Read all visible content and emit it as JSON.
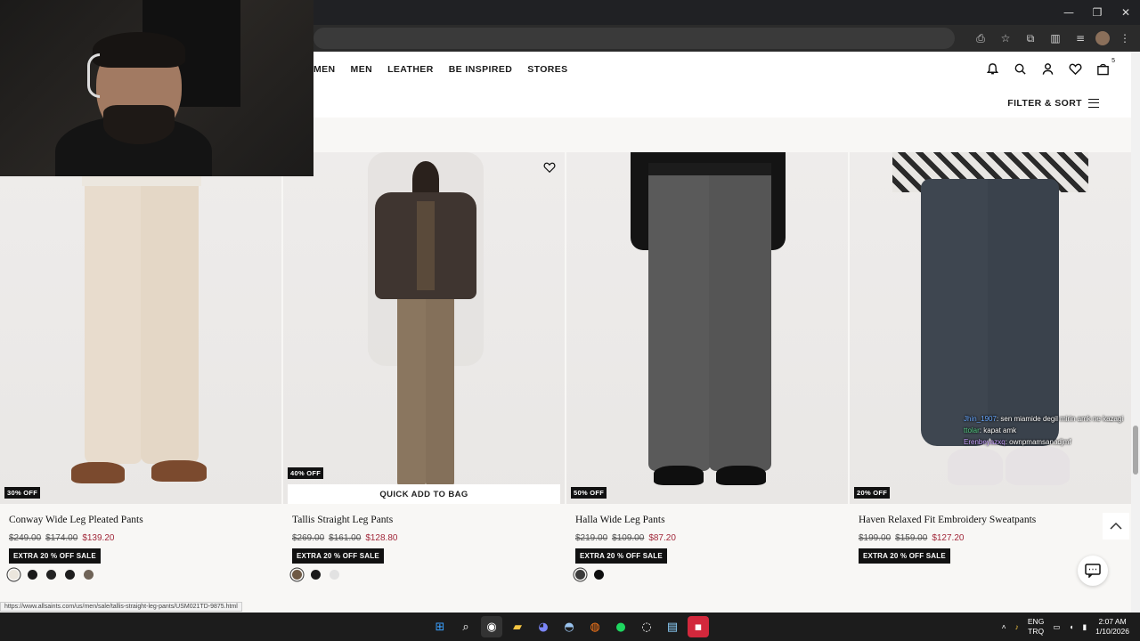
{
  "window": {
    "minimize": "—",
    "restore": "❐",
    "close": "✕"
  },
  "toolbar_icons": [
    "install-icon",
    "star-icon",
    "extensions-icon",
    "sidepanel-icon",
    "cast-icon",
    "profile-avatar",
    "menu-icon"
  ],
  "nav": {
    "links": [
      "MEN",
      "MEN",
      "LEATHER",
      "BE INSPIRED",
      "STORES"
    ],
    "bag_count": "5"
  },
  "filter": {
    "label": "FILTER & SORT"
  },
  "products": [
    {
      "name": "Conway Wide Leg Pleated Pants",
      "original": "$249.00",
      "was": "$174.00",
      "sale": "$139.20",
      "discount": "30% OFF",
      "badge": "EXTRA 20 % OFF SALE",
      "swatches": [
        "#ebe6dd",
        "#1a1a1a",
        "#232323",
        "#1e1e1e",
        "#6f6357"
      ],
      "pants_color": "#e8dccd",
      "top_color": "#ece7df"
    },
    {
      "name": "Tallis Straight Leg Pants",
      "original": "$269.00",
      "was": "$161.00",
      "sale": "$128.80",
      "discount": "40% OFF",
      "badge": "EXTRA 20 % OFF SALE",
      "swatches": [
        "#6f5a45",
        "#1a1a1a",
        "#e2e2e2"
      ],
      "pants_color": "#8a765f",
      "top_color": "#3f3530",
      "quick_add": "QUICK ADD TO BAG"
    },
    {
      "name": "Halla Wide Leg Pants",
      "original": "$219.00",
      "was": "$109.00",
      "sale": "$87.20",
      "discount": "50% OFF",
      "badge": "EXTRA 20 % OFF SALE",
      "swatches": [
        "#3b3b3b",
        "#0f0f0f"
      ],
      "pants_color": "#5a5a5a",
      "top_color": "#141414"
    },
    {
      "name": "Haven Relaxed Fit Embroidery Sweatpants",
      "original": "$199.00",
      "was": "$159.00",
      "sale": "$127.20",
      "discount": "20% OFF",
      "badge": "EXTRA 20 % OFF SALE",
      "swatches": [],
      "pants_color": "#3e4650",
      "top_color": "#e8e6e3"
    }
  ],
  "chat_overlay": [
    {
      "user": "Jhin_1907",
      "msg": ": sen miamide degil mirin amk ne kazagi"
    },
    {
      "user": "ttolar",
      "msg": ": kapat amk"
    },
    {
      "user": "Erenbeyazxq",
      "msg": ": ownpmamsanadjmf"
    }
  ],
  "status_url": "https://www.allsaints.com/us/men/sale/tallis-straight-leg-pants/USM021TD-9875.html",
  "taskbar": {
    "apps": [
      "windows-start-icon",
      "search-icon",
      "chrome-icon",
      "file-explorer-icon",
      "discord-icon",
      "steam-icon",
      "app-icon",
      "spotify-icon",
      "obs-icon",
      "notepad-icon",
      "app-red-icon"
    ],
    "lang_top": "ENG",
    "lang_bottom": "TRQ",
    "time": "2:07 AM",
    "date": "1/10/2026"
  }
}
